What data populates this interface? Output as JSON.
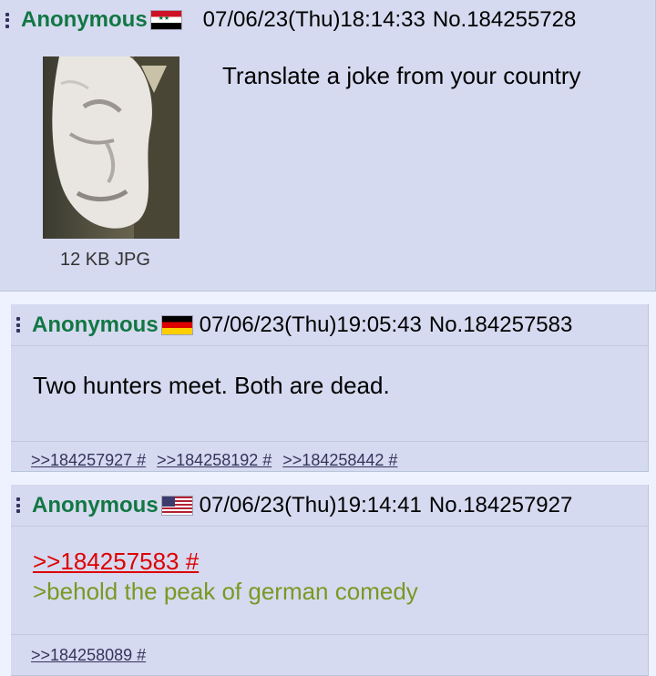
{
  "posts": [
    {
      "name": "Anonymous",
      "flag": "syria-flag-icon",
      "datetime": "07/06/23(Thu)18:14:33",
      "number": "No.184255728",
      "image_info": "12 KB JPG",
      "message": "Translate a joke from your country"
    },
    {
      "name": "Anonymous",
      "flag": "germany-flag-icon",
      "datetime": "07/06/23(Thu)19:05:43",
      "number": "No.184257583",
      "message": "Two hunters meet. Both are dead.",
      "backlinks": [
        ">>184257927 #",
        ">>184258192 #",
        ">>184258442 #"
      ]
    },
    {
      "name": "Anonymous",
      "flag": "usa-flag-icon",
      "datetime": "07/06/23(Thu)19:14:41",
      "number": "No.184257927",
      "quote": ">>184257583 #",
      "greentext": ">behold the peak of german comedy",
      "backlinks": [
        ">>184258089 #"
      ]
    }
  ],
  "colors": {
    "name": "#117743",
    "post_bg": "#d6daf0",
    "page_bg": "#eef2ff",
    "greentext": "#789922",
    "link": "#34345c",
    "quote_link": "#dd0000"
  }
}
